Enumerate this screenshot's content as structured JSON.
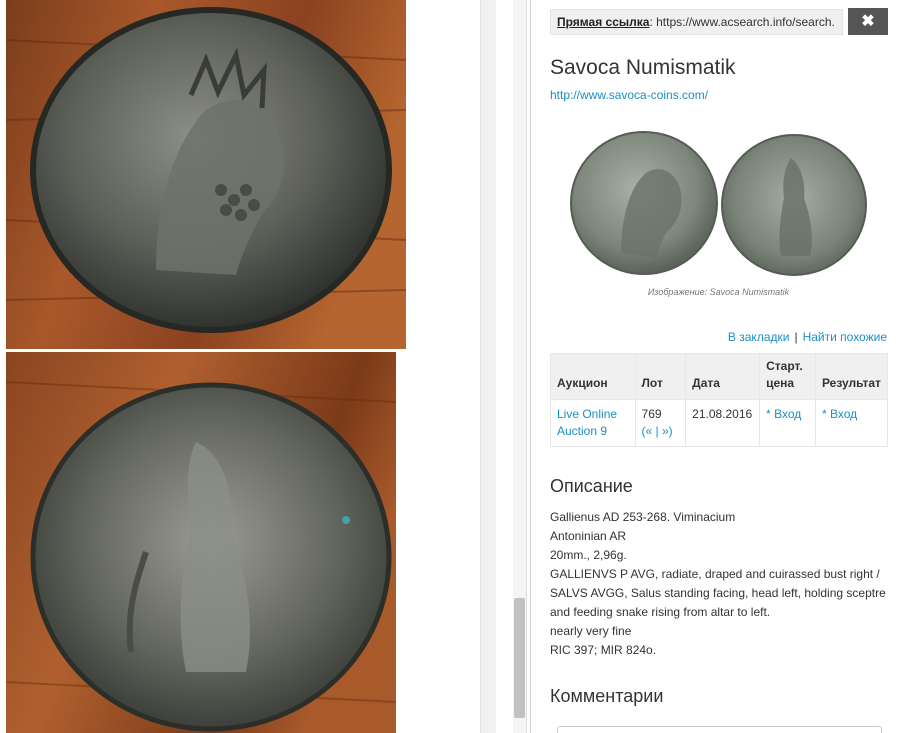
{
  "photos": {
    "obverse": {
      "name": "coin-obverse-photo"
    },
    "reverse": {
      "name": "coin-reverse-photo"
    }
  },
  "panel": {
    "direct_link_label": "Прямая ссылка",
    "direct_link_url": ": https://www.acsearch.info/search.",
    "close_icon": "✖",
    "dealer_name": "Savoca Numismatik",
    "dealer_url": "http://www.savoca-coins.com/",
    "image_caption": "Изображение: Savoca Numismatik",
    "bookmark_label": "В закладки",
    "separator": "|",
    "find_similar_label": "Найти похожие",
    "table": {
      "headers": [
        "Аукцион",
        "Лот",
        "Дата",
        "Старт. цена",
        "Результат"
      ],
      "row": {
        "auction": "Live Online Auction 9",
        "lot": "769",
        "lot_nav": "(« | »)",
        "date": "21.08.2016",
        "start_price": "* Вход",
        "result": "* Вход"
      }
    },
    "description_heading": "Описание",
    "description_lines": [
      "Gallienus AD 253-268. Viminacium",
      "Antoninian AR",
      "20mm., 2,96g.",
      "GALLIENVS P AVG, radiate, draped and cuirassed bust right /",
      "SALVS AVGG, Salus standing facing, head left, holding sceptre",
      "and feeding snake rising from altar to left.",
      "nearly very fine",
      "RIC 397; MIR 824o."
    ],
    "comments_heading": "Комментарии"
  },
  "colors": {
    "link": "#1a8fc4",
    "close_button": "#555555",
    "table_header_bg": "#f0f0f0"
  }
}
